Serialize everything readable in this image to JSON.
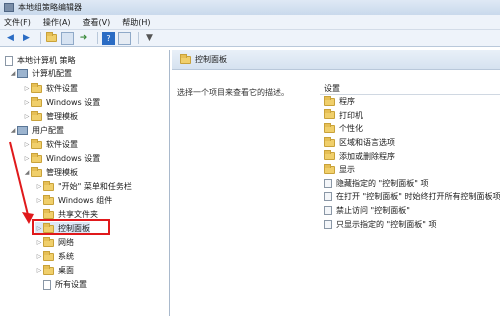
{
  "window": {
    "title": "本地组策略编辑器"
  },
  "menu": {
    "file": "文件(F)",
    "action": "操作(A)",
    "view": "查看(V)",
    "help": "帮助(H)"
  },
  "toolbar": [
    "back-icon",
    "forward-icon",
    "folder-up-icon",
    "show-tree-icon",
    "export-icon",
    "help-icon",
    "properties-icon",
    "filter-icon"
  ],
  "tree": {
    "root": "本地计算机 策略",
    "computer_config": "计算机配置",
    "computer_children": [
      "软件设置",
      "Windows 设置",
      "管理模板"
    ],
    "user_config": "用户配置",
    "user_children": [
      "软件设置",
      "Windows 设置",
      "管理模板"
    ],
    "admin_children": [
      "\"开始\" 菜单和任务栏",
      "Windows 组件",
      "共享文件夹",
      "控制面板",
      "网络",
      "系统",
      "桌面",
      "所有设置"
    ]
  },
  "right": {
    "header": "控制面板",
    "description": "选择一个项目来查看它的描述。",
    "column_header": "设置",
    "folders": [
      "程序",
      "打印机",
      "个性化",
      "区域和语言选项",
      "添加或删除程序",
      "显示"
    ],
    "settings": [
      "隐藏指定的 \"控制面板\" 项",
      "在打开 \"控制面板\" 时始终打开所有控制面板项",
      "禁止访问 \"控制面板\"",
      "只显示指定的 \"控制面板\" 项"
    ]
  },
  "colors": {
    "highlight": "#e0191b",
    "annotation_arrow": "#e0191b"
  }
}
